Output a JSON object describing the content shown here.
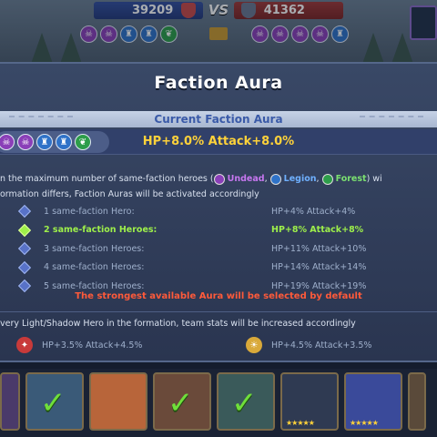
{
  "battle": {
    "left_score": "39209",
    "vs_label": "VS",
    "right_score": "41362"
  },
  "modal": {
    "title": "Faction Aura",
    "current_label": "Current Faction Aura",
    "current_stat": "HP+8.0% Attack+8.0%",
    "intro_prefix": "n the maximum number of same-faction heroes (",
    "undead": "Undead",
    "legion": "Legion",
    "forest": "Forest",
    "intro_suffix": ") wi",
    "intro_line2": "ormation differs, Faction Auras will be activated accordingly",
    "tiers": [
      {
        "label": "1 same-faction Hero:",
        "stat": "HP+4% Attack+4%"
      },
      {
        "label": "2 same-faction Heroes:",
        "stat": "HP+8% Attack+8%"
      },
      {
        "label": "3 same-faction Heroes:",
        "stat": "HP+11% Attack+10%"
      },
      {
        "label": "4 same-faction Heroes:",
        "stat": "HP+14% Attack+14%"
      },
      {
        "label": "5 same-faction Heroes:",
        "stat": "HP+19% Attack+19%"
      }
    ],
    "note": "The strongest available Aura will be selected by default",
    "light_shadow_intro": "very Light/Shadow Hero in the formation, team stats will be increased accordingly",
    "light_stat": "HP+3.5% Attack+4.5%",
    "shadow_stat": "HP+4.5% Attack+3.5%"
  },
  "colors": {
    "undead": "#8a3fb8",
    "legion": "#2f72c8",
    "forest": "#2d9d4a",
    "active_tier": "#9ef04a",
    "current_stat": "#ffd23a",
    "note": "#ff5a3a"
  }
}
